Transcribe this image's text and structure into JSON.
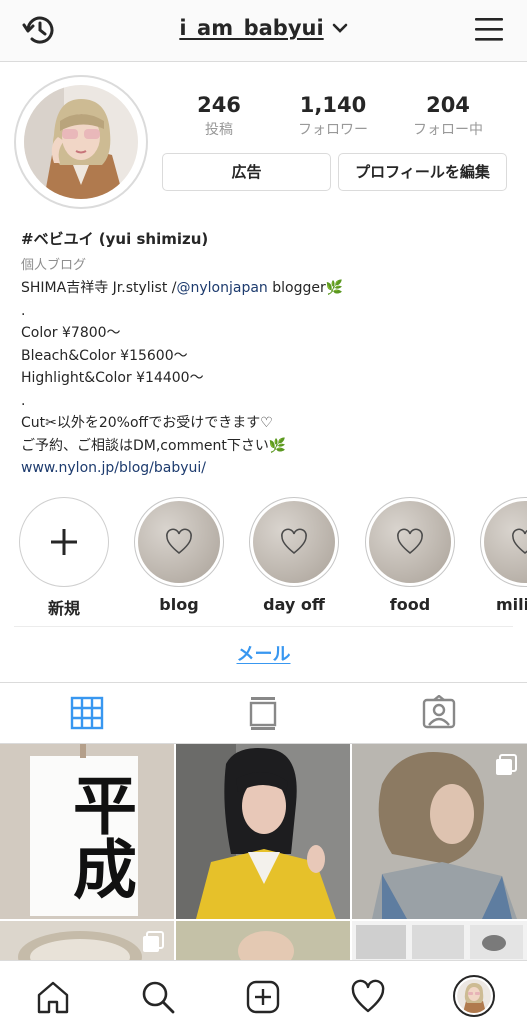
{
  "header": {
    "username": "i_am_babyui",
    "history_icon": "history-icon",
    "menu_icon": "hamburger-menu-icon",
    "dropdown_icon": "chevron-down-icon"
  },
  "profile": {
    "stats": {
      "posts_count": "246",
      "posts_label": "投稿",
      "followers_count": "1,140",
      "followers_label": "フォロワー",
      "following_count": "204",
      "following_label": "フォロー中"
    },
    "buttons": {
      "ad_label": "広告",
      "edit_label": "プロフィールを編集"
    },
    "bio": {
      "name": "#ベビユイ (yui shimizu)",
      "category": "個人ブログ",
      "line1_pre": "SHIMA吉祥寺 Jr.stylist /",
      "line1_mention": "@nylonjapan",
      "line1_post": " blogger🌿",
      "dot1": ".",
      "line2": "Color ¥7800〜",
      "line3": "Bleach&Color ¥15600〜",
      "line4": "Highlight&Color ¥14400〜",
      "dot2": ".",
      "line5": "Cut✂以外を20%offでお受けできます♡",
      "line6": "ご予約、ご相談はDM,comment下さい🌿",
      "website": "www.nylon.jp/blog/babyui/"
    }
  },
  "highlights": {
    "new_label": "新規",
    "items": [
      {
        "label": "blog"
      },
      {
        "label": "day off"
      },
      {
        "label": "food"
      },
      {
        "label": "mili"
      }
    ]
  },
  "contact": {
    "email_label": "メール"
  },
  "tabs": {
    "grid_icon": "grid-icon",
    "feed_icon": "feed-icon",
    "tagged_icon": "tagged-person-icon"
  },
  "grid_posts": {
    "post1_text": "平成"
  },
  "bottom_nav": {
    "home_icon": "home-icon",
    "search_icon": "search-icon",
    "add_icon": "add-post-icon",
    "activity_icon": "heart-icon",
    "profile_icon": "profile-avatar-icon"
  },
  "colors": {
    "accent_blue": "#3897f0",
    "link_navy": "#1d3b6e",
    "border": "#dbdbdb",
    "muted": "#999999"
  }
}
